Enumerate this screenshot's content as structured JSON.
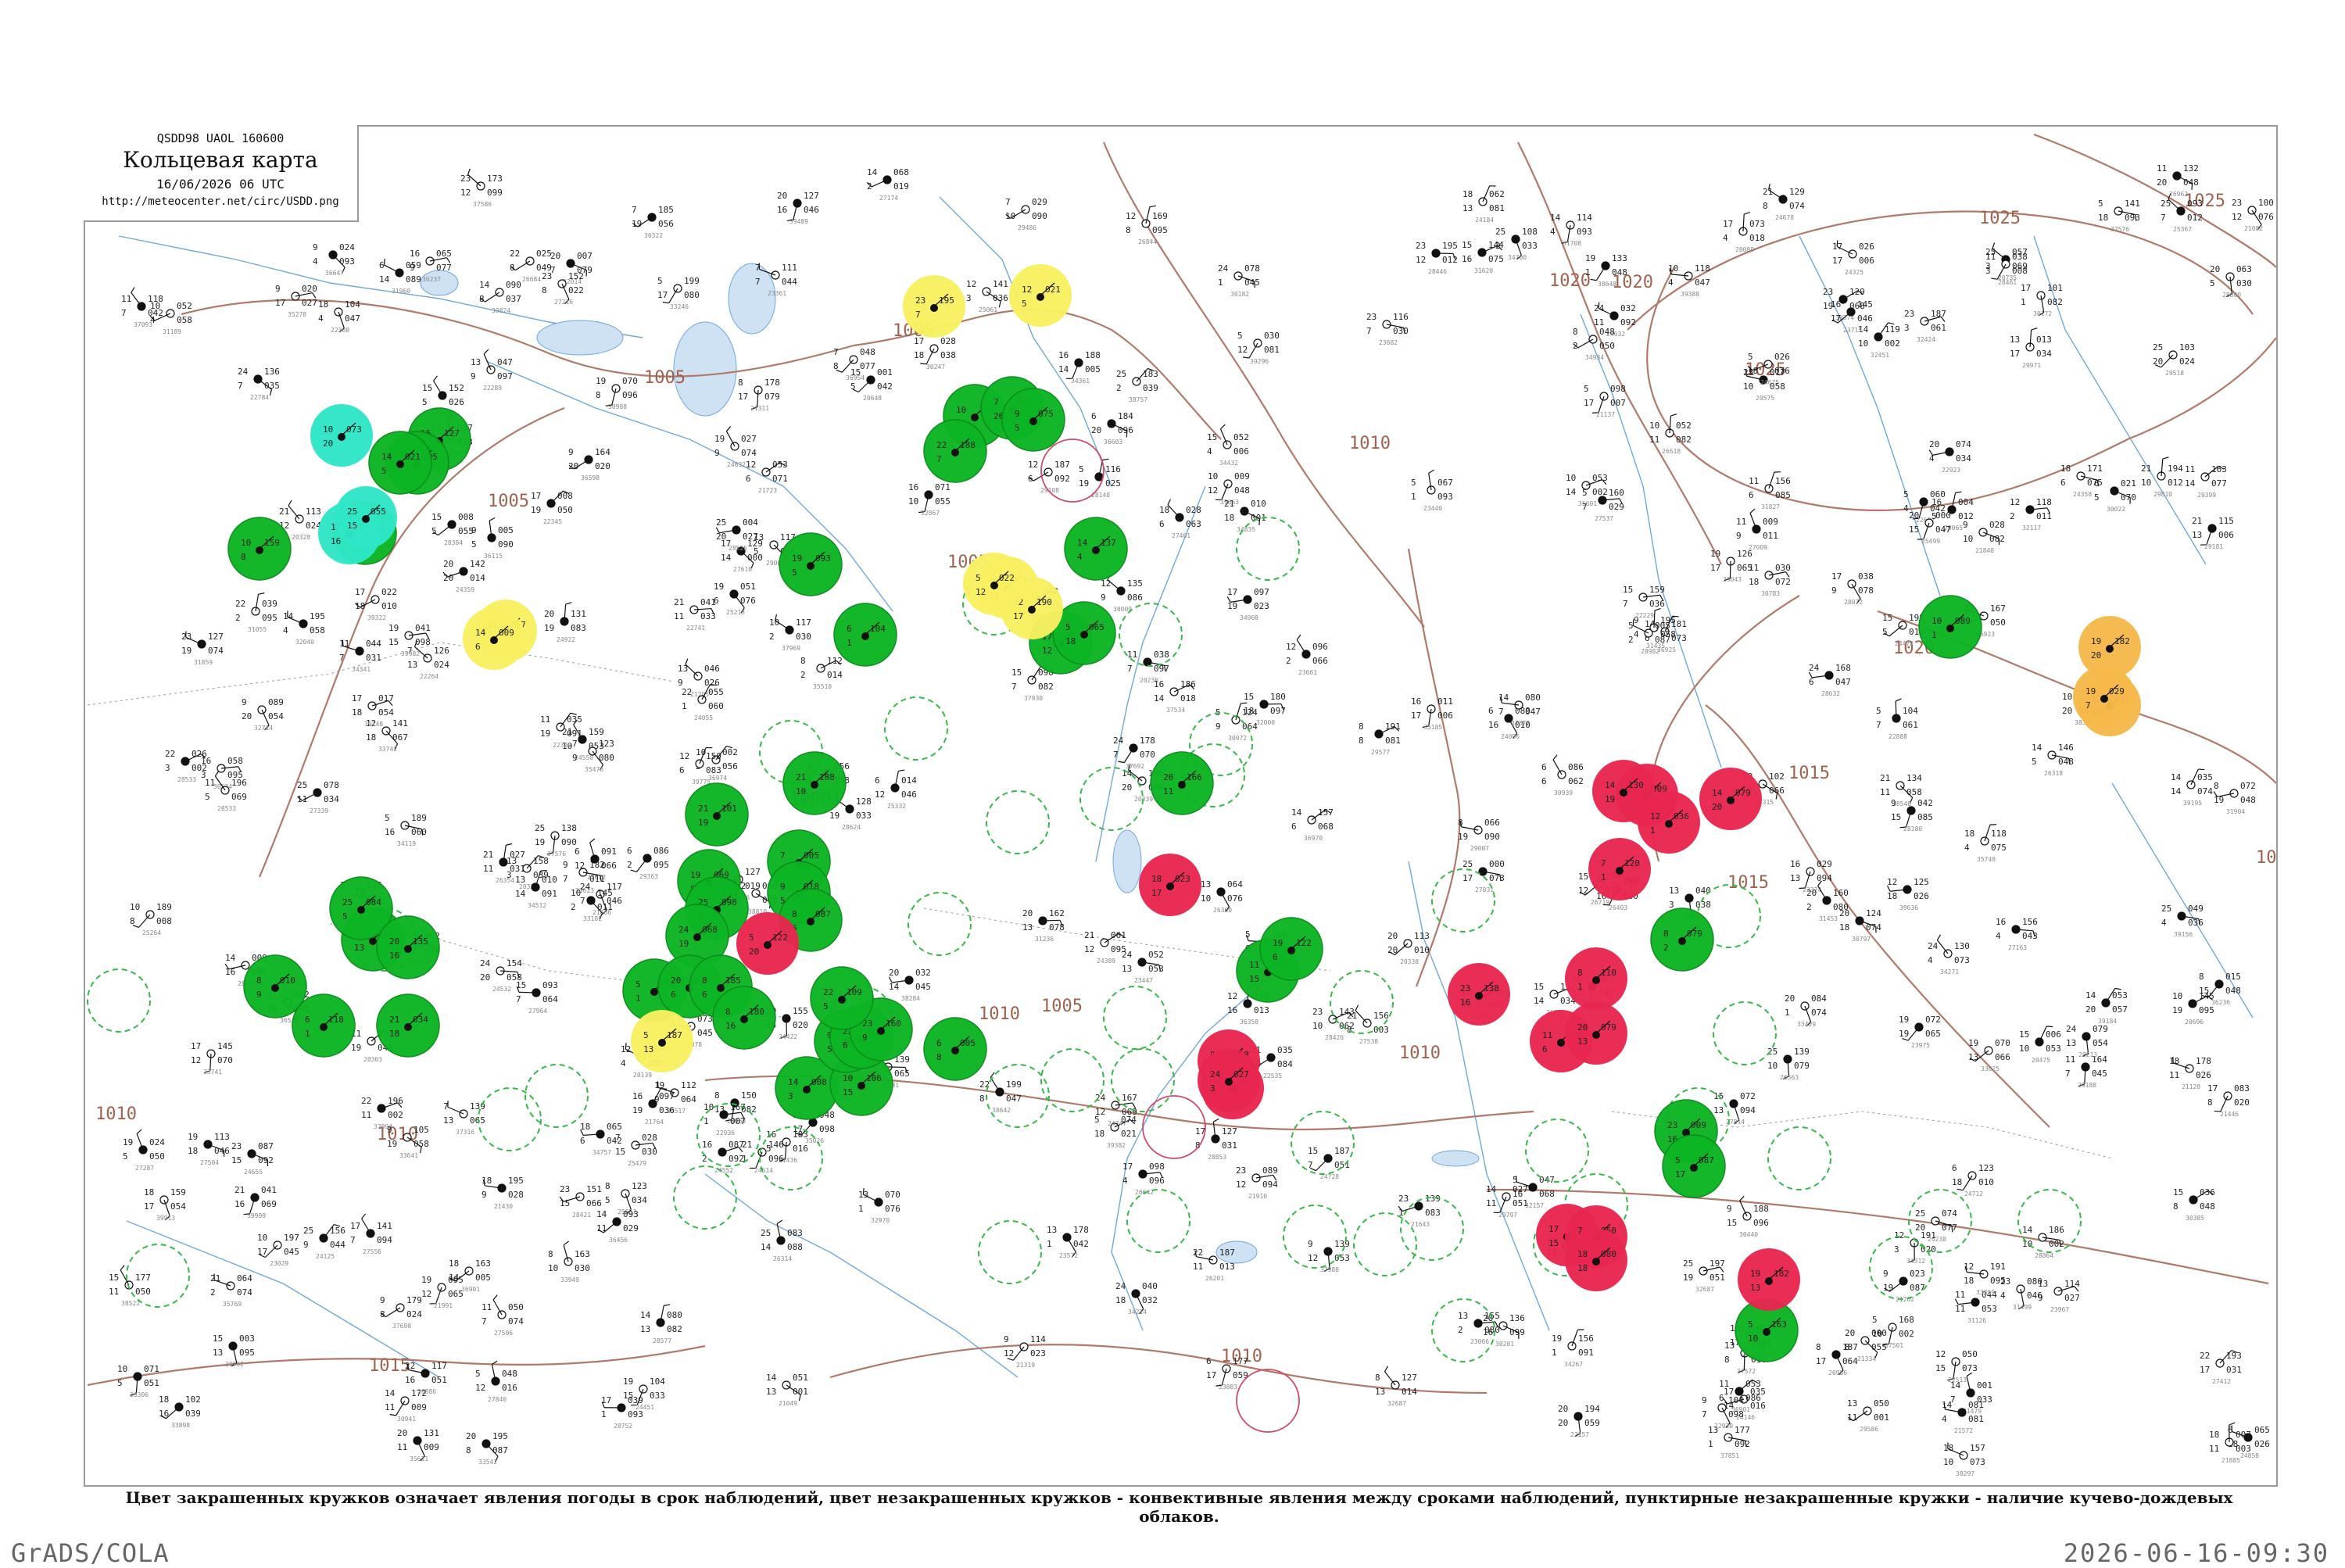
{
  "legend": {
    "code_line": "QSDD98  UAOL  160600",
    "title": "Кольцевая карта",
    "datetime": "16/06/2026 06 UTC",
    "url": "http://meteocenter.net/circ/USDD.png"
  },
  "caption": "Цвет закрашенных кружков означает явления погоды в срок наблюдений, цвет незакрашенных кружков - конвективные явления между сроками наблюдений, пунктирные незакрашенные кружки - наличие кучево-дождевых облаков.",
  "footer": {
    "software": "GrADS/COLA",
    "timestamp": "2026-06-16-09:30"
  },
  "isobar_labels": [
    "1000",
    "1005",
    "1005",
    "1005",
    "1005",
    "1005",
    "1010",
    "1010",
    "1010",
    "1010",
    "1010",
    "1010",
    "1015",
    "1015",
    "1015",
    "1015",
    "1020",
    "1020",
    "1020",
    "1025",
    "1025",
    "1025"
  ],
  "colors": {
    "green": "#0cb523",
    "red": "#e8264f",
    "yellow": "#f8f060",
    "orange": "#f6b94a",
    "cyan": "#2ee6c6",
    "dashed_outline": "#38b84a",
    "isobar": "#b07a6a",
    "water": "#6fa8dc"
  },
  "station_stats": {
    "filled_green": 52,
    "filled_red": 18,
    "filled_yellow": 8,
    "filled_orange": 3,
    "filled_cyan": 3
  }
}
